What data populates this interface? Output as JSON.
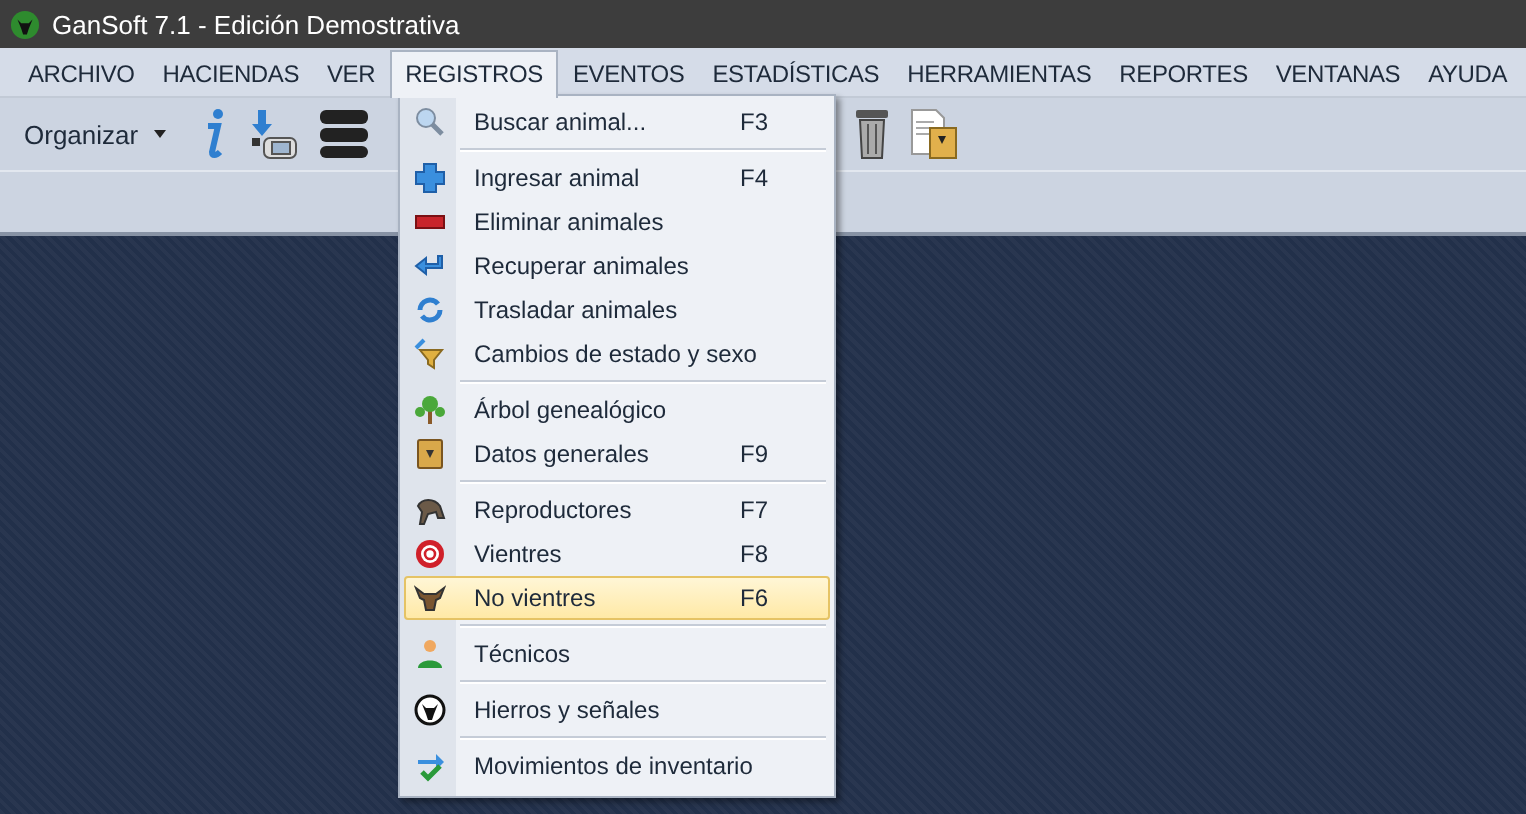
{
  "window": {
    "title": "GanSoft 7.1 - Edición Demostrativa"
  },
  "menu_bar": [
    {
      "label": "ARCHIVO",
      "selected": false
    },
    {
      "label": "HACIENDAS",
      "selected": false
    },
    {
      "label": "VER",
      "selected": false
    },
    {
      "label": "REGISTROS",
      "selected": true
    },
    {
      "label": "EVENTOS",
      "selected": false
    },
    {
      "label": "ESTADÍSTICAS",
      "selected": false
    },
    {
      "label": "HERRAMIENTAS",
      "selected": false
    },
    {
      "label": "REPORTES",
      "selected": false
    },
    {
      "label": "VENTANAS",
      "selected": false
    },
    {
      "label": "AYUDA",
      "selected": false
    }
  ],
  "toolbar": {
    "organize_label": "Organizar"
  },
  "dropdown": [
    {
      "kind": "item",
      "label": "Buscar animal...",
      "shortcut": "F3",
      "selected": false
    },
    {
      "kind": "separator"
    },
    {
      "kind": "item",
      "label": "Ingresar animal",
      "shortcut": "F4",
      "selected": false
    },
    {
      "kind": "item",
      "label": "Eliminar animales",
      "selected": false
    },
    {
      "kind": "item",
      "label": "Recuperar animales",
      "selected": false
    },
    {
      "kind": "item",
      "label": "Trasladar animales",
      "selected": false
    },
    {
      "kind": "item",
      "label": "Cambios de estado y sexo",
      "selected": false
    },
    {
      "kind": "separator"
    },
    {
      "kind": "item",
      "label": "Árbol genealógico",
      "selected": false
    },
    {
      "kind": "item",
      "label": "Datos generales",
      "shortcut": "F9",
      "selected": false
    },
    {
      "kind": "separator"
    },
    {
      "kind": "item",
      "label": "Reproductores",
      "shortcut": "F7",
      "selected": false
    },
    {
      "kind": "item",
      "label": "Vientres",
      "shortcut": "F8",
      "selected": false
    },
    {
      "kind": "item",
      "label": "No vientres",
      "shortcut": "F6",
      "selected": true
    },
    {
      "kind": "separator"
    },
    {
      "kind": "item",
      "label": "Técnicos",
      "selected": false
    },
    {
      "kind": "separator"
    },
    {
      "kind": "item",
      "label": "Hierros y señales",
      "selected": false
    },
    {
      "kind": "separator"
    },
    {
      "kind": "item",
      "label": "Movimientos de inventario",
      "selected": false
    }
  ]
}
